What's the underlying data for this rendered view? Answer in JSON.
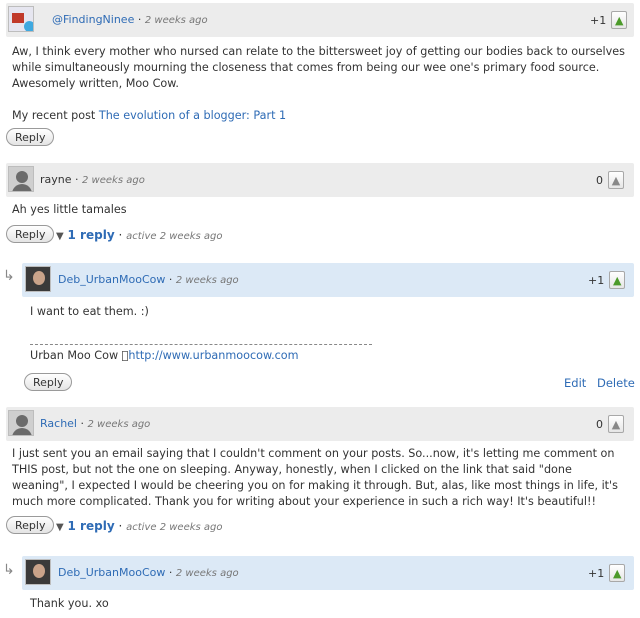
{
  "comments": [
    {
      "author": "@FindingNinee",
      "time": "2 weeks ago",
      "votes": "+1",
      "body_lines": [
        "Aw, I think every mother who nursed can relate to the bittersweet joy of getting our bodies back to ourselves",
        "while simultaneously mourning the closeness that comes from being our wee one's primary food source.",
        "Awesomely written, Moo Cow."
      ],
      "recent_post_prefix": "My recent post",
      "recent_post_link": "The evolution of a blogger: Part 1",
      "reply_label": "Reply"
    },
    {
      "author": "rayne",
      "time": "2 weeks ago",
      "votes": "0",
      "body": "Ah yes little tamales",
      "reply_label": "Reply",
      "replies_count": "1 reply",
      "replies_active": "active 2 weeks ago"
    },
    {
      "author": "Deb_UrbanMooCow",
      "time": "2 weeks ago",
      "votes": "+1",
      "body": "I want to eat them. :)",
      "signature_prefix": "Urban Moo Cow \u0000",
      "signature_link": "http://www.urbanmoocow.com",
      "reply_label": "Reply",
      "edit_label": "Edit",
      "delete_label": "Delete"
    },
    {
      "author": "Rachel",
      "time": "2 weeks ago",
      "votes": "0",
      "body_lines": [
        "I just sent you an email saying that I couldn't comment on your posts. So...now, it's letting me comment on",
        "THIS post, but not the one on sleeping. Anyway, honestly, when I clicked on the link that said \"done",
        "weaning\", I expected I would be cheering you on for making it through. But, alas, like most things in life, it's",
        "much more complicated. Thank you for writing about your experience in such a rich way! It's beautiful!!"
      ],
      "reply_label": "Reply",
      "replies_count": "1 reply",
      "replies_active": "active 2 weeks ago"
    },
    {
      "author": "Deb_UrbanMooCow",
      "time": "2 weeks ago",
      "votes": "+1",
      "body": "Thank you. xo"
    }
  ],
  "separator": "·",
  "reply_arrow": "↳",
  "thumb_icon": "👍",
  "signature_rule": "------------------------------------------------------------------------"
}
